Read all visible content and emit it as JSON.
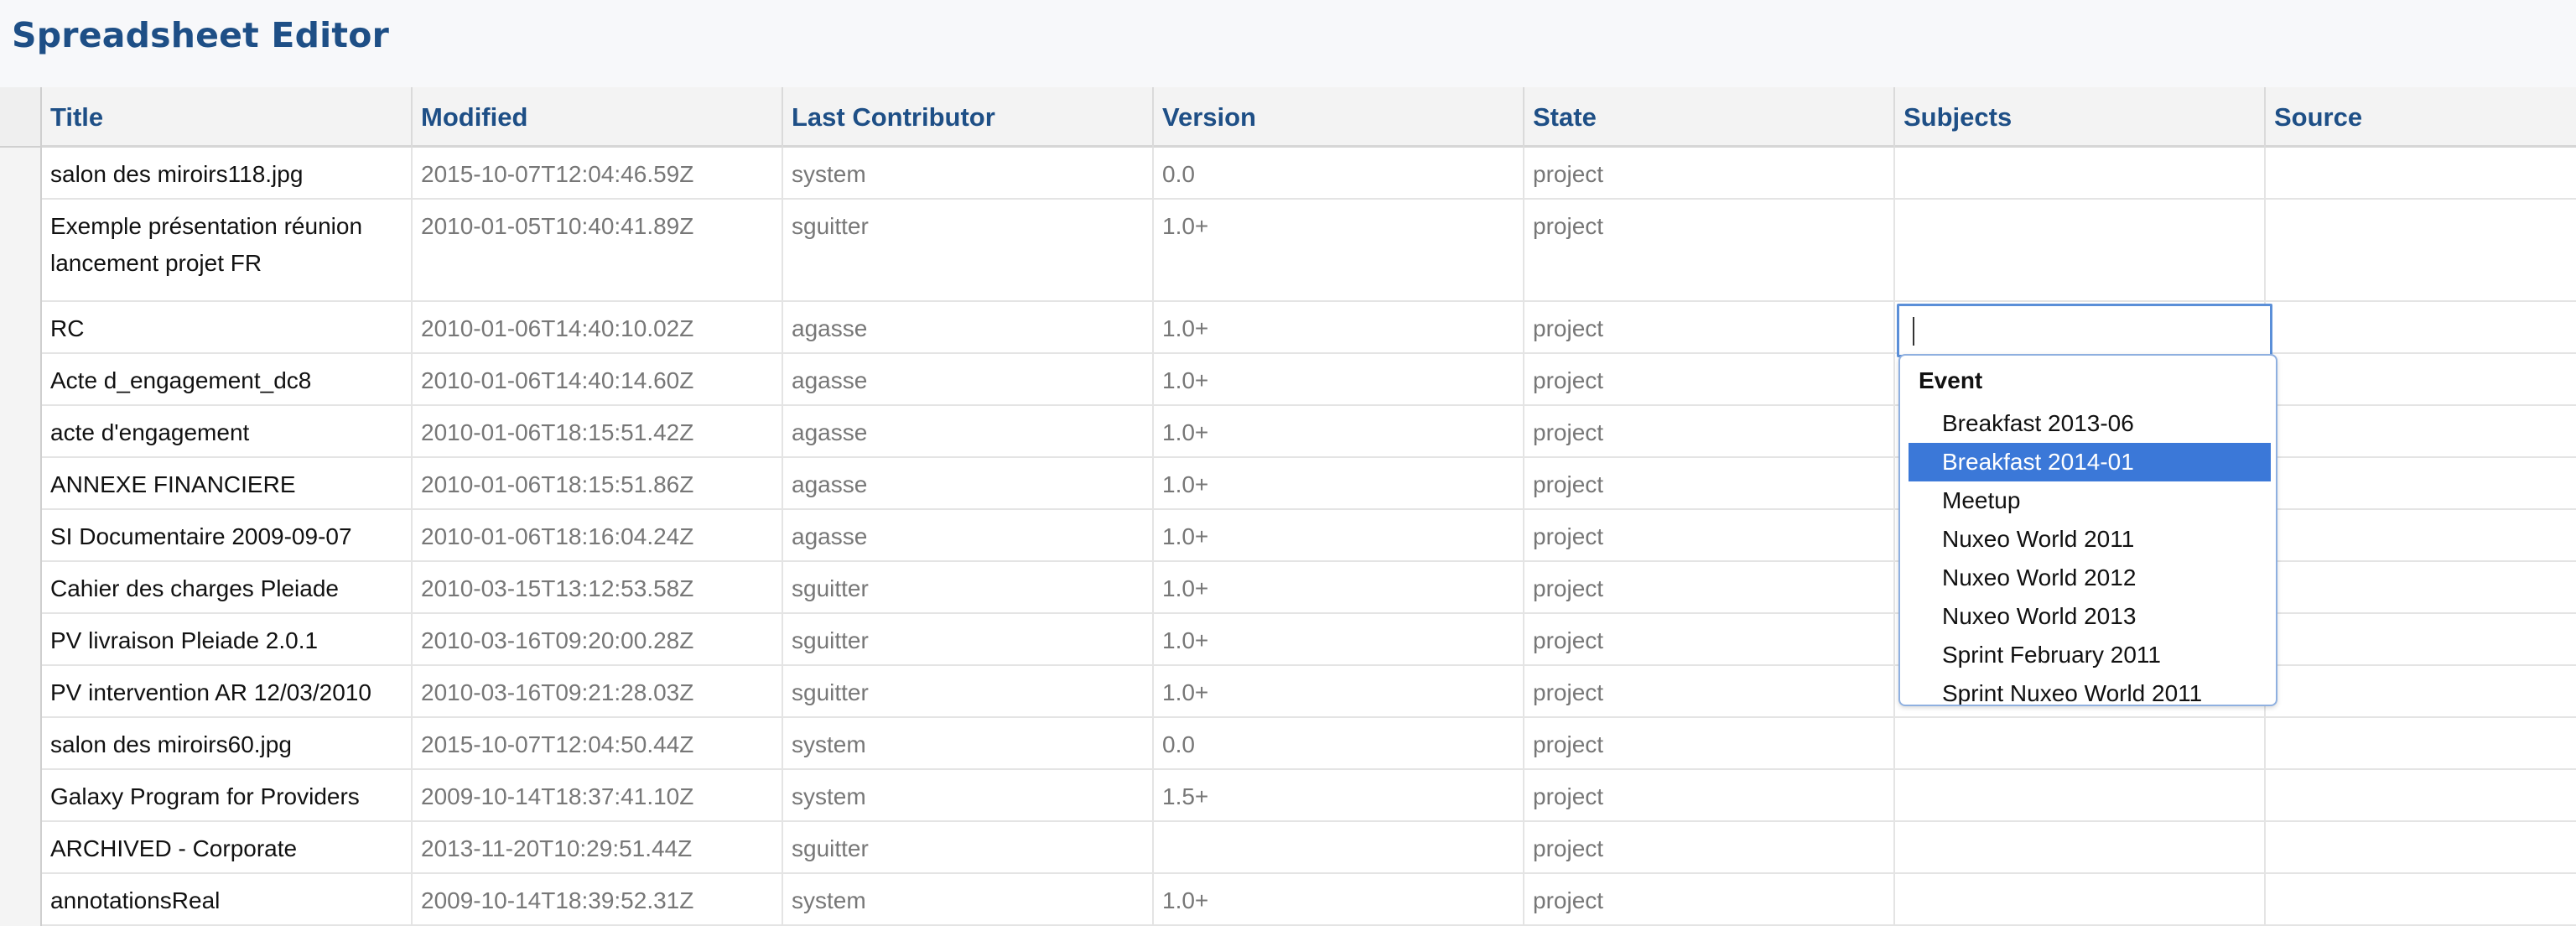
{
  "app": {
    "title": "Spreadsheet Editor"
  },
  "columns": [
    "Title",
    "Modified",
    "Last Contributor",
    "Version",
    "State",
    "Subjects",
    "Source"
  ],
  "rows": [
    [
      "salon des miroirs118.jpg",
      "2015-10-07T12:04:46.59Z",
      "system",
      "0.0",
      "project",
      "",
      ""
    ],
    [
      "Exemple présentation réunion lancement projet FR",
      "2010-01-05T10:40:41.89Z",
      "sguitter",
      "1.0+",
      "project",
      "",
      ""
    ],
    [
      "RC",
      "2010-01-06T14:40:10.02Z",
      "agasse",
      "1.0+",
      "project",
      "",
      ""
    ],
    [
      "Acte d_engagement_dc8",
      "2010-01-06T14:40:14.60Z",
      "agasse",
      "1.0+",
      "project",
      "",
      ""
    ],
    [
      "acte d'engagement",
      "2010-01-06T18:15:51.42Z",
      "agasse",
      "1.0+",
      "project",
      "",
      ""
    ],
    [
      "ANNEXE FINANCIERE",
      "2010-01-06T18:15:51.86Z",
      "agasse",
      "1.0+",
      "project",
      "",
      ""
    ],
    [
      "SI Documentaire 2009-09-07",
      "2010-01-06T18:16:04.24Z",
      "agasse",
      "1.0+",
      "project",
      "",
      ""
    ],
    [
      "Cahier des charges Pleiade",
      "2010-03-15T13:12:53.58Z",
      "sguitter",
      "1.0+",
      "project",
      "",
      ""
    ],
    [
      "PV livraison Pleiade 2.0.1",
      "2010-03-16T09:20:00.28Z",
      "sguitter",
      "1.0+",
      "project",
      "",
      ""
    ],
    [
      "PV intervention AR 12/03/2010",
      "2010-03-16T09:21:28.03Z",
      "sguitter",
      "1.0+",
      "project",
      "",
      ""
    ],
    [
      "salon des miroirs60.jpg",
      "2015-10-07T12:04:50.44Z",
      "system",
      "0.0",
      "project",
      "",
      ""
    ],
    [
      "Galaxy Program for Providers",
      "2009-10-14T18:37:41.10Z",
      "system",
      "1.5+",
      "project",
      "",
      ""
    ],
    [
      "ARCHIVED - Corporate",
      "2013-11-20T10:29:51.44Z",
      "sguitter",
      "",
      "project",
      "",
      ""
    ],
    [
      "annotationsReal",
      "2009-10-14T18:39:52.31Z",
      "system",
      "1.0+",
      "project",
      "",
      ""
    ]
  ],
  "subjects_editor": {
    "value": "",
    "group": "Event",
    "options": [
      "Breakfast 2013-06",
      "Breakfast 2014-01",
      "Meetup",
      "Nuxeo World 2011",
      "Nuxeo World 2012",
      "Nuxeo World 2013",
      "Sprint February 2011",
      "Sprint Nuxeo World 2011"
    ],
    "selected_option": "Breakfast 2014-01"
  },
  "colors": {
    "header_text": "#1e4f86",
    "selected_option_bg": "#3b78d8",
    "editor_border": "#5b8fd8"
  }
}
